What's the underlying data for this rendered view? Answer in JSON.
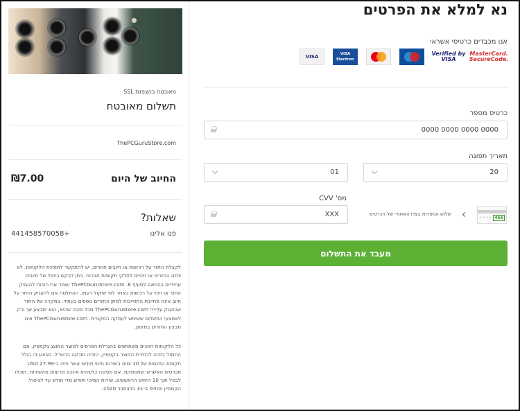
{
  "header": {
    "title": "נא למלא את הפרטים"
  },
  "cards_section": {
    "label": "אנו מכבדים כרטיסי אשראי",
    "logos": [
      {
        "name": "visa",
        "text": "VISA"
      },
      {
        "name": "visa-electron",
        "text": "VISA Electron"
      },
      {
        "name": "mastercard",
        "text": "MasterCard"
      },
      {
        "name": "maestro",
        "text": "Maestro"
      },
      {
        "name": "verified-by-visa",
        "text": "Verified by VISA"
      },
      {
        "name": "mastercard-securecode",
        "text": "MasterCard. SecureCode."
      }
    ]
  },
  "form": {
    "card_number_label": "כרטיס מספר",
    "card_number_value": "0000 0000 0000 0000",
    "expiry_label": "תאריך תפוגה",
    "expiry_month": "01",
    "expiry_year": "20",
    "cvv_label": "מס' CVV",
    "cvv_value": "XXX",
    "cvv_help": "שלוש הספרות בצדו האחורי של הכרטיס",
    "cvv_example": "456",
    "submit_label": "מעבד את התשלום"
  },
  "summary": {
    "ssl_label": "מאובטח בהצפנת SSL",
    "secure_title": "תשלום מאובטח",
    "store_name": "ThePCGuruStore.com",
    "today_label": "החיוב של היום",
    "today_amount": "₪7.00",
    "questions_title": "שאלות?",
    "contact_label": "פנו אלינו",
    "contact_phone": "441458570058+"
  },
  "legal": {
    "paragraph1": "לקבלת החזר על רכישות או חיובים חוזרים, יש להתקשר לתמיכת הלקוחות. לא ינתנו החזרים או זיכויים לחלקי תקופות חברות. ניתן לבקש ביטול של חיובים עתידיים בהתאם לסעיף 8. ThePCGuruStore.com שומר את הזכות להעניק החזר או זיכוי על רכישות באחר לפי שיקול דעתו. ההחלטה אם להעניק החזר על חיוב אינה מחייבת התחייבות למתן החזרים נוספים בעתיד. במקרה של החזר שהוענק על-ידי ThePCGuruStore.com מכל סיבה שהיא, הוא יתבצע אך ורק לאמצעי התשלום ששימש לעסקה המקורית. ThePCGuruStore.com אינו מבצע החזרים במזומן.",
    "paragraph2": "כל הלקוחות הזוכים משתתפים בהגרלת הפרסים למוצר המוצג בקמפיין. אם התמזל בזכיה לבחירת המוצר בקמפיין, הזכיה תודעה בדוא\"ל. מבצע זה כולל תקופת התנסות של 10 ימים בשירות מינוי חודשי אשר חייב ב-27.99 USD מכרטיס האשראי שתספקת. אם מסיבה כלשהיא אינכם מרוצים מהשירות, תוכלו לבטל תוך 10 הימים הראשונים. שירות המינוי יחודש מדי חודש עד לביטול. הקמפיין יסתיים ב-31 בדצמבר 2020."
  }
}
